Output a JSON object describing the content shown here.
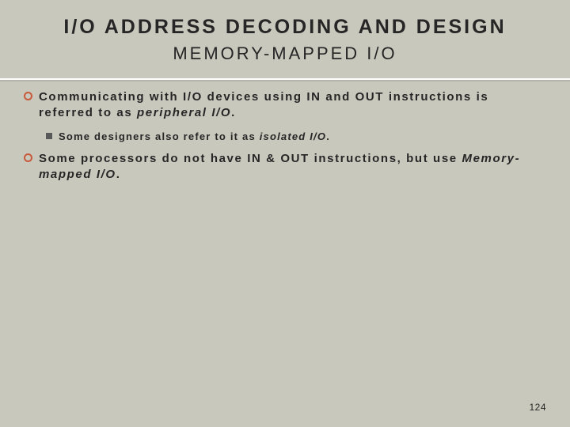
{
  "title": "I/O ADDRESS DECODING AND DESIGN",
  "subtitle": "MEMORY-MAPPED I/O",
  "bullets": {
    "b1_pre": "Communicating with I/O devices using IN and OUT instructions is referred to as ",
    "b1_ital": "peripheral I/O",
    "b1_post": ".",
    "b1a_pre": "Some designers also refer to it as ",
    "b1a_ital": "isolated I/O",
    "b1a_post": ".",
    "b2_pre": "Some processors do not have IN & OUT instructions, but use ",
    "b2_ital": "Memory-mapped I/O",
    "b2_post": "."
  },
  "page_number": "124"
}
